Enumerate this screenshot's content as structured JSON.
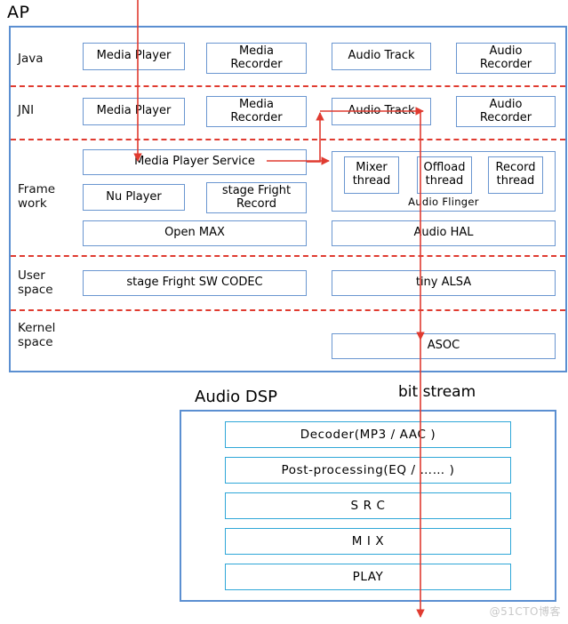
{
  "diagram": {
    "ap_title": "AP",
    "dsp_title": "Audio DSP",
    "bit_stream_label": "bit stream",
    "watermark": "@51CTO博客",
    "colors": {
      "outer_border": "#5b8fd1",
      "inner_border": "#6a96d0",
      "dsp_border": "#2fa7d8",
      "divider": "#e03b30",
      "flow_arrow": "#e03b30",
      "text": "#000000",
      "background": "#ffffff"
    }
  },
  "ap": {
    "layers": [
      {
        "name": "Java",
        "label": "Java"
      },
      {
        "name": "JNI",
        "label": "JNI"
      },
      {
        "name": "Framework",
        "label": "Frame\nwork"
      },
      {
        "name": "User space",
        "label": "User\nspace"
      },
      {
        "name": "Kernel space",
        "label": "Kernel\nspace"
      }
    ],
    "java_row": [
      {
        "label": "Media Player"
      },
      {
        "label": "Media\nRecorder"
      },
      {
        "label": "Audio Track"
      },
      {
        "label": "Audio\nRecorder"
      }
    ],
    "jni_row": [
      {
        "label": "Media Player"
      },
      {
        "label": "Media\nRecorder"
      },
      {
        "label": "Audio Track"
      },
      {
        "label": "Audio\nRecorder"
      }
    ],
    "framework": {
      "media_player_service": "Media Player Service",
      "nu_player": "Nu Player",
      "stage_fright_record": "stage Fright\nRecord",
      "open_max": "Open MAX",
      "audio_flinger_label": "Audio   Flinger",
      "threads": [
        {
          "label": "Mixer\nthread"
        },
        {
          "label": "Offload\nthread"
        },
        {
          "label": "Record\nthread"
        }
      ],
      "audio_hal": "Audio HAL"
    },
    "user_space": [
      {
        "label": "stage Fright  SW  CODEC"
      },
      {
        "label": "tiny ALSA"
      }
    ],
    "kernel_space": [
      {
        "label": "ASOC"
      }
    ]
  },
  "dsp": {
    "blocks": [
      {
        "label": "Decoder(MP3 / AAC )"
      },
      {
        "label": "Post-processing(EQ / …… )"
      },
      {
        "label": "S R C"
      },
      {
        "label": "M I X"
      },
      {
        "label": "PLAY"
      }
    ]
  }
}
